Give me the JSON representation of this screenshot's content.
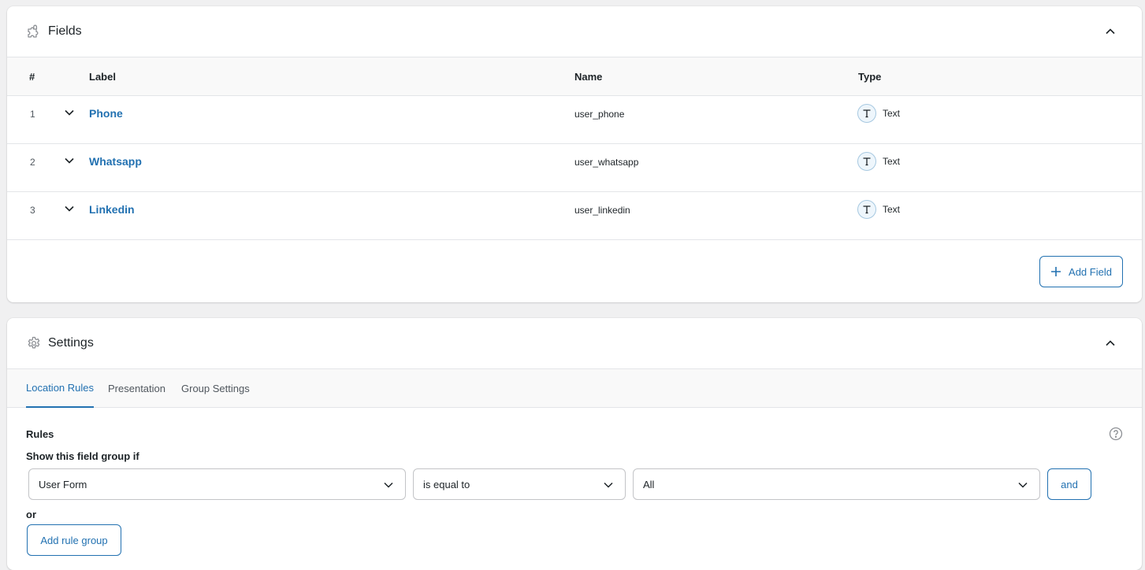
{
  "colors": {
    "accent": "#2271b1",
    "background": "#f0f0f1",
    "border": "#e3e5e8",
    "text": "#1d2327",
    "muted": "#50575e"
  },
  "fields_panel": {
    "title": "Fields",
    "icon": "puzzle-icon",
    "columns": {
      "num": "#",
      "label": "Label",
      "name": "Name",
      "type": "Type"
    },
    "rows": [
      {
        "num": "1",
        "label": "Phone",
        "name": "user_phone",
        "type": "Text",
        "type_icon": "text-type-icon"
      },
      {
        "num": "2",
        "label": "Whatsapp",
        "name": "user_whatsapp",
        "type": "Text",
        "type_icon": "text-type-icon"
      },
      {
        "num": "3",
        "label": "Linkedin",
        "name": "user_linkedin",
        "type": "Text",
        "type_icon": "text-type-icon"
      }
    ],
    "add_field_label": "Add Field"
  },
  "settings_panel": {
    "title": "Settings",
    "icon": "gear-icon",
    "tabs": [
      {
        "label": "Location Rules",
        "active": true
      },
      {
        "label": "Presentation",
        "active": false
      },
      {
        "label": "Group Settings",
        "active": false
      }
    ],
    "rules_title": "Rules",
    "rules_subtitle": "Show this field group if",
    "rule": {
      "param": "User Form",
      "operator": "is equal to",
      "value": "All"
    },
    "and_label": "and",
    "or_label": "or",
    "add_rule_group_label": "Add rule group"
  }
}
